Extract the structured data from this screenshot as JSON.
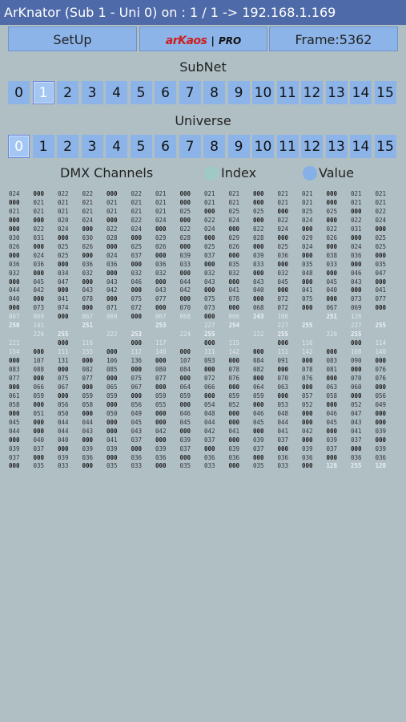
{
  "title": "ArKnator (Sub 1 - Uni 0) on : 1 / 1 -> 192.168.1.169",
  "toolbar": {
    "setup_label": "SetUp",
    "logo_left": "arKaos",
    "logo_sep": "|",
    "logo_right": "PRO",
    "frame_label": "Frame:5362"
  },
  "subnet": {
    "label": "SubNet",
    "selected": 1,
    "values": [
      "0",
      "1",
      "2",
      "3",
      "4",
      "5",
      "6",
      "7",
      "8",
      "9",
      "10",
      "11",
      "12",
      "13",
      "14",
      "15"
    ]
  },
  "universe": {
    "label": "Universe",
    "selected": 0,
    "values": [
      "0",
      "1",
      "2",
      "3",
      "4",
      "5",
      "6",
      "7",
      "8",
      "9",
      "10",
      "11",
      "12",
      "13",
      "14",
      "15"
    ]
  },
  "dmx": {
    "label": "DMX Channels",
    "index_label": "Index",
    "value_label": "Value",
    "colors": {
      "index_dot": "#9fcac4",
      "value_dot": "#86b0e8"
    },
    "rows": [
      [
        "024",
        "000",
        "022",
        "022",
        "000",
        "022",
        "021",
        "000",
        "021",
        "021",
        "000",
        "021",
        "021",
        "000",
        "021",
        "021"
      ],
      [
        "000",
        "021",
        "021",
        "021",
        "021",
        "021",
        "021",
        "000",
        "021",
        "021",
        "000",
        "021",
        "021",
        "000",
        "021",
        "021"
      ],
      [
        "021",
        "021",
        "021",
        "021",
        "021",
        "021",
        "021",
        "025",
        "000",
        "025",
        "025",
        "000",
        "025",
        "025",
        "000",
        "022"
      ],
      [
        "000",
        "000",
        "020",
        "024",
        "000",
        "022",
        "024",
        "000",
        "022",
        "024",
        "000",
        "022",
        "024",
        "000",
        "022",
        "024"
      ],
      [
        "000",
        "022",
        "024",
        "000",
        "022",
        "024",
        "000",
        "022",
        "024",
        "000",
        "022",
        "024",
        "000",
        "022",
        "031",
        "000"
      ],
      [
        "030",
        "031",
        "000",
        "030",
        "028",
        "000",
        "029",
        "028",
        "000",
        "029",
        "028",
        "000",
        "029",
        "026",
        "000",
        "025"
      ],
      [
        "026",
        "000",
        "025",
        "026",
        "000",
        "025",
        "026",
        "000",
        "025",
        "026",
        "000",
        "025",
        "024",
        "000",
        "024",
        "025"
      ],
      [
        "000",
        "024",
        "025",
        "000",
        "024",
        "037",
        "000",
        "039",
        "037",
        "000",
        "039",
        "036",
        "000",
        "038",
        "036",
        "000"
      ],
      [
        "036",
        "036",
        "000",
        "036",
        "036",
        "000",
        "036",
        "033",
        "000",
        "035",
        "033",
        "000",
        "035",
        "033",
        "000",
        "035"
      ],
      [
        "032",
        "000",
        "034",
        "032",
        "000",
        "032",
        "032",
        "000",
        "032",
        "032",
        "000",
        "032",
        "048",
        "000",
        "046",
        "047"
      ],
      [
        "000",
        "045",
        "047",
        "000",
        "043",
        "046",
        "000",
        "044",
        "043",
        "000",
        "043",
        "045",
        "000",
        "045",
        "043",
        "000"
      ],
      [
        "044",
        "042",
        "000",
        "043",
        "042",
        "000",
        "043",
        "042",
        "000",
        "041",
        "040",
        "000",
        "041",
        "040",
        "000",
        "041"
      ],
      [
        "040",
        "000",
        "041",
        "078",
        "000",
        "075",
        "077",
        "000",
        "075",
        "078",
        "000",
        "072",
        "075",
        "000",
        "073",
        "077"
      ],
      [
        "000",
        "073",
        "074",
        "000",
        "071",
        "072",
        "000",
        "070",
        "073",
        "000",
        "068",
        "072",
        "000",
        "067",
        "069",
        "000"
      ],
      [
        "067",
        "069",
        "000",
        "067",
        "069",
        "000",
        "067",
        "068",
        "000",
        "066",
        "243",
        "108",
        "",
        "251",
        "126",
        ""
      ],
      [
        "250",
        "141",
        "",
        "251",
        "",
        "",
        "253",
        "",
        "227",
        "254",
        "",
        "227",
        "255",
        "",
        "227",
        "255"
      ],
      [
        "",
        "226",
        "255",
        "",
        "222",
        "253",
        "",
        "224",
        "255",
        "",
        "222",
        "255",
        "",
        "220",
        "255",
        ""
      ],
      [
        "221",
        "",
        "000",
        "116",
        "",
        "000",
        "117",
        "",
        "000",
        "115",
        "",
        "000",
        "116",
        "",
        "000",
        "114"
      ],
      [
        "154",
        "000",
        "111",
        "155",
        "000",
        "112",
        "140",
        "000",
        "111",
        "142",
        "000",
        "111",
        "142",
        "000",
        "108",
        "140"
      ],
      [
        "000",
        "107",
        "131",
        "000",
        "106",
        "136",
        "000",
        "107",
        "093",
        "000",
        "084",
        "091",
        "000",
        "083",
        "090",
        "000"
      ],
      [
        "083",
        "088",
        "000",
        "082",
        "085",
        "000",
        "080",
        "084",
        "000",
        "078",
        "082",
        "000",
        "078",
        "081",
        "000",
        "076"
      ],
      [
        "077",
        "000",
        "075",
        "077",
        "000",
        "075",
        "077",
        "000",
        "072",
        "076",
        "000",
        "070",
        "076",
        "000",
        "070",
        "076"
      ],
      [
        "000",
        "066",
        "067",
        "000",
        "065",
        "067",
        "000",
        "064",
        "066",
        "000",
        "064",
        "063",
        "000",
        "063",
        "060",
        "000"
      ],
      [
        "061",
        "059",
        "000",
        "059",
        "059",
        "000",
        "059",
        "059",
        "000",
        "059",
        "059",
        "000",
        "057",
        "058",
        "000",
        "056"
      ],
      [
        "058",
        "000",
        "056",
        "058",
        "000",
        "056",
        "055",
        "000",
        "054",
        "052",
        "000",
        "053",
        "052",
        "000",
        "052",
        "049"
      ],
      [
        "000",
        "051",
        "050",
        "000",
        "050",
        "049",
        "000",
        "046",
        "048",
        "000",
        "046",
        "048",
        "000",
        "046",
        "047",
        "000"
      ],
      [
        "045",
        "000",
        "044",
        "044",
        "000",
        "045",
        "000",
        "045",
        "044",
        "000",
        "045",
        "044",
        "000",
        "045",
        "043",
        "000"
      ],
      [
        "044",
        "000",
        "044",
        "043",
        "000",
        "043",
        "042",
        "000",
        "042",
        "041",
        "000",
        "041",
        "042",
        "000",
        "041",
        "039"
      ],
      [
        "000",
        "040",
        "040",
        "000",
        "041",
        "037",
        "000",
        "039",
        "037",
        "000",
        "039",
        "037",
        "000",
        "039",
        "037",
        "000"
      ],
      [
        "039",
        "037",
        "000",
        "039",
        "039",
        "000",
        "039",
        "037",
        "000",
        "039",
        "037",
        "000",
        "039",
        "037",
        "000",
        "039"
      ],
      [
        "037",
        "000",
        "039",
        "036",
        "000",
        "036",
        "036",
        "000",
        "036",
        "036",
        "000",
        "036",
        "036",
        "000",
        "036",
        "036"
      ],
      [
        "000",
        "035",
        "033",
        "000",
        "035",
        "033",
        "000",
        "035",
        "033",
        "000",
        "035",
        "033",
        "000",
        "128",
        "255",
        "128"
      ]
    ]
  }
}
